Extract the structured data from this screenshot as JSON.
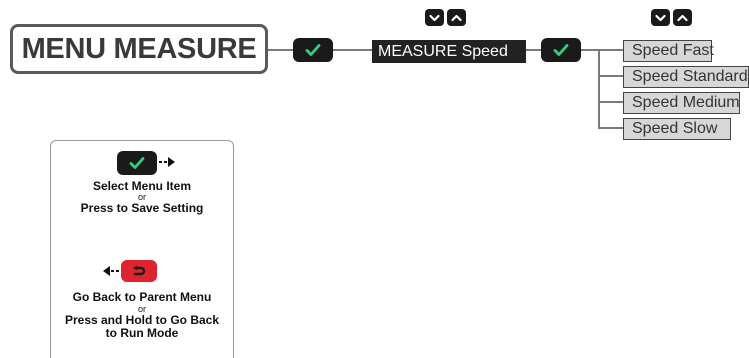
{
  "title": "MENU MEASURE",
  "submenu": {
    "label": "MEASURE Speed"
  },
  "options": [
    "Speed Fast",
    "Speed Standard",
    "Speed Medium",
    "Speed Slow"
  ],
  "legend": {
    "select_line1": "Select Menu Item",
    "select_or": "or",
    "select_line2": "Press to Save Setting",
    "back_line1": "Go Back to Parent Menu",
    "back_or": "or",
    "back_line2": "Press and Hold to Go Back",
    "back_line3": "to Run Mode"
  },
  "icons": {
    "select": "check-icon",
    "back": "return-icon",
    "scroll_down": "chevron-down-icon",
    "scroll_up": "chevron-up-icon"
  },
  "colors": {
    "button_dark": "#1a1a1a",
    "check_green": "#2fd27f",
    "back_red": "#e0242f",
    "option_fill": "#d7d7d7",
    "connector": "#7a7a7a"
  }
}
